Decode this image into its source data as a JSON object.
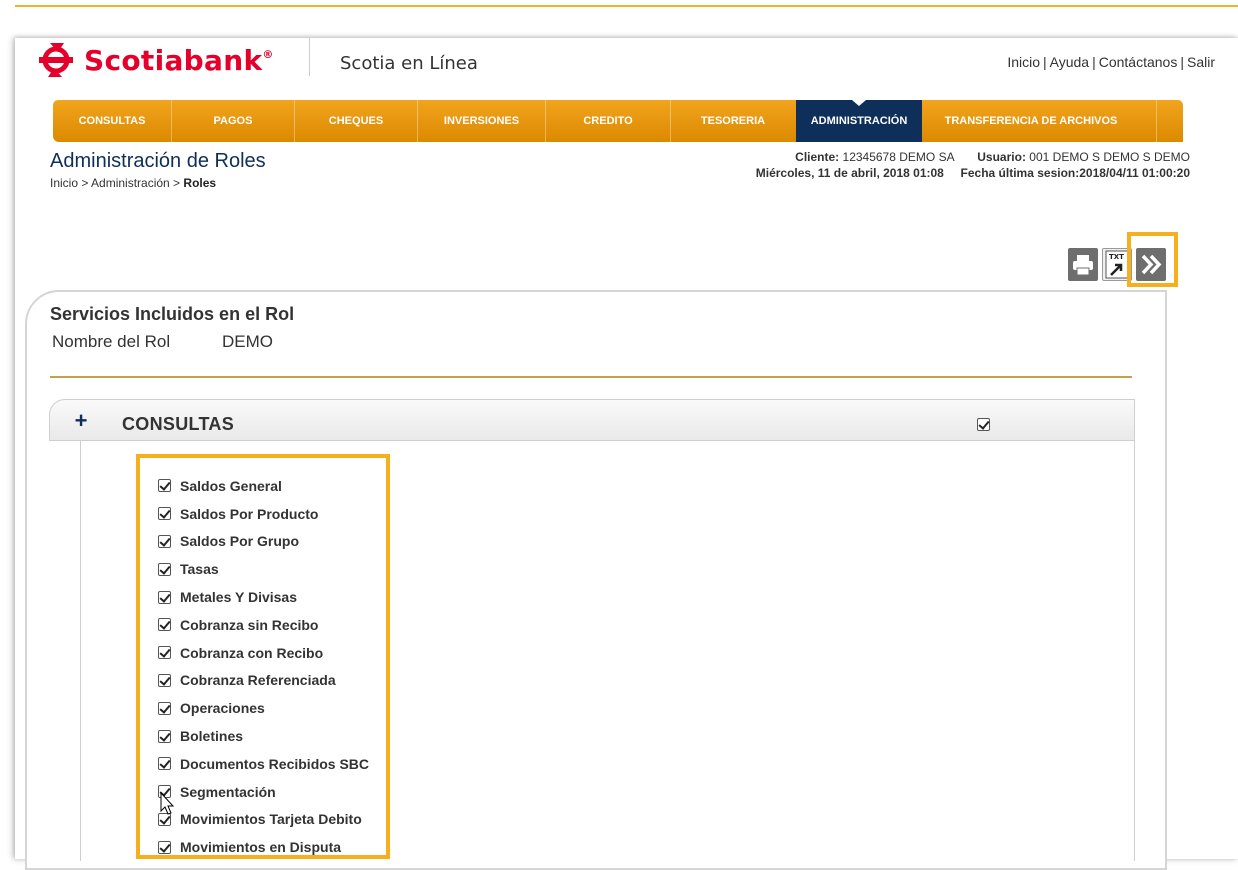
{
  "header": {
    "brand": "Scotiabank",
    "app_name": "Scotia en Línea",
    "links": [
      "Inicio",
      "Ayuda",
      "Contáctanos",
      "Salir"
    ]
  },
  "nav": {
    "items": [
      "CONSULTAS",
      "PAGOS",
      "CHEQUES",
      "INVERSIONES",
      "CREDITO",
      "TESORERIA",
      "ADMINISTRACIÓN",
      "TRANSFERENCIA DE ARCHIVOS"
    ],
    "active": "ADMINISTRACIÓN"
  },
  "page": {
    "title": "Administración de Roles",
    "breadcrumb_prefix": "Inicio > Administración > ",
    "breadcrumb_current": "Roles"
  },
  "meta": {
    "cliente_label": "Cliente:",
    "cliente_value": "12345678  DEMO SA",
    "usuario_label": "Usuario:",
    "usuario_value": "001 DEMO S DEMO S DEMO",
    "fecha": "Miércoles, 11 de abril, 2018 01:08",
    "ultima_sesion_label": "Fecha última sesion:",
    "ultima_sesion_value": "2018/04/11 01:00:20"
  },
  "toolbar": {
    "print_icon": "printer-icon",
    "txt_icon": "txt-export-icon",
    "txt_label": "TXT",
    "next_icon": "double-chevron-right-icon"
  },
  "panel": {
    "title": "Servicios Incluidos en el Rol",
    "role_name_label": "Nombre del Rol",
    "role_name_value": "DEMO"
  },
  "section": {
    "expand_symbol": "+",
    "title": "CONSULTAS",
    "checked": true
  },
  "services": [
    {
      "label": "Saldos General",
      "checked": true
    },
    {
      "label": "Saldos Por Producto",
      "checked": true
    },
    {
      "label": "Saldos Por Grupo",
      "checked": true
    },
    {
      "label": "Tasas",
      "checked": true
    },
    {
      "label": "Metales Y Divisas",
      "checked": true
    },
    {
      "label": "Cobranza sin Recibo",
      "checked": true
    },
    {
      "label": "Cobranza con Recibo",
      "checked": true
    },
    {
      "label": "Cobranza Referenciada",
      "checked": true
    },
    {
      "label": "Operaciones",
      "checked": true
    },
    {
      "label": "Boletines",
      "checked": true
    },
    {
      "label": "Documentos Recibidos SBC",
      "checked": true
    },
    {
      "label": "Segmentación",
      "checked": true
    },
    {
      "label": "Movimientos Tarjeta Debito",
      "checked": true
    },
    {
      "label": "Movimientos en Disputa",
      "checked": true
    }
  ],
  "colors": {
    "brand_red": "#e4002b",
    "nav_orange": "#e69400",
    "nav_active": "#0e2f59",
    "highlight": "#f6b01e"
  }
}
